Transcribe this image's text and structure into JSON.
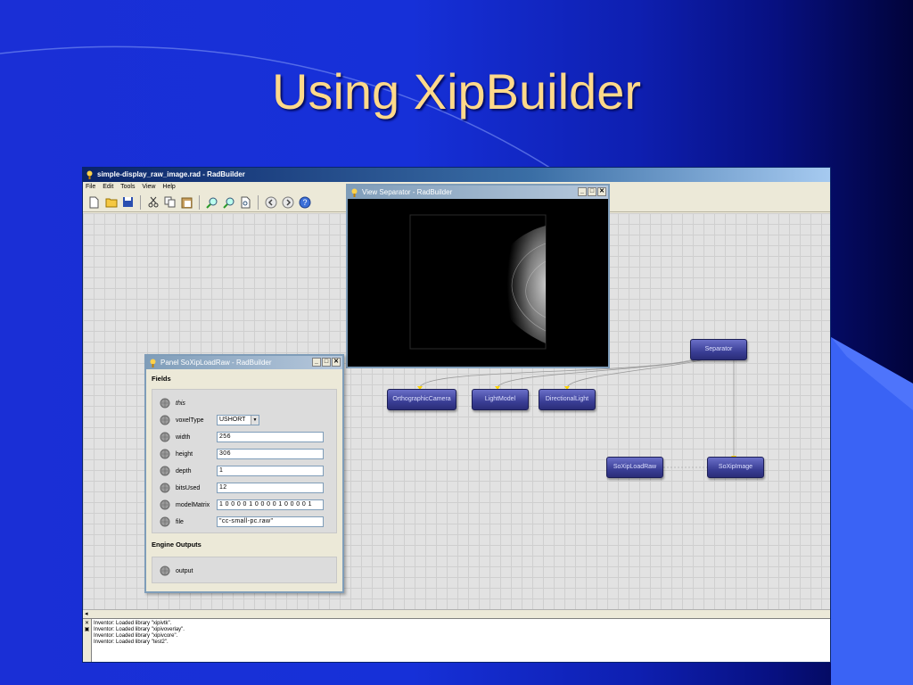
{
  "slide": {
    "title": "Using XipBuilder"
  },
  "main_window": {
    "title": "simple-display_raw_image.rad - RadBuilder",
    "menu": [
      "File",
      "Edit",
      "Tools",
      "View",
      "Help"
    ]
  },
  "view_window": {
    "title": "View Separator - RadBuilder"
  },
  "panel_window": {
    "title": "Panel SoXipLoadRaw - RadBuilder",
    "fields_label": "Fields",
    "outputs_label": "Engine Outputs",
    "fields": [
      {
        "name": "this",
        "value": ""
      },
      {
        "name": "voxelType",
        "value": "USHORT"
      },
      {
        "name": "width",
        "value": "256"
      },
      {
        "name": "height",
        "value": "306"
      },
      {
        "name": "depth",
        "value": "1"
      },
      {
        "name": "bitsUsed",
        "value": "12"
      },
      {
        "name": "modelMatrix",
        "value": "1 0 0 0 0 1 0 0 0 0 1 0 0 0 0 1"
      },
      {
        "name": "file",
        "value": "\"cc-small-pc.raw\""
      }
    ],
    "outputs": [
      {
        "name": "output"
      }
    ]
  },
  "nodes": {
    "separator": "Separator",
    "ortho_camera": "OrthographicCamera",
    "light_model": "LightModel",
    "directional_light": "DirectionalLight",
    "load_raw": "SoXipLoadRaw",
    "xip_image": "SoXipImage"
  },
  "scroll": {
    "left_arrow": "◂"
  },
  "log": {
    "lines": [
      "Inventor: Loaded library \"xipivtk\".",
      "Inventor: Loaded library \"xipivoverlay\".",
      "Inventor: Loaded library \"xipivcore\".",
      "Inventor: Loaded library \"test2\"."
    ]
  },
  "colors": {
    "title": "#ffd98a",
    "node": "#3b3f96",
    "background": "#1630d8"
  }
}
